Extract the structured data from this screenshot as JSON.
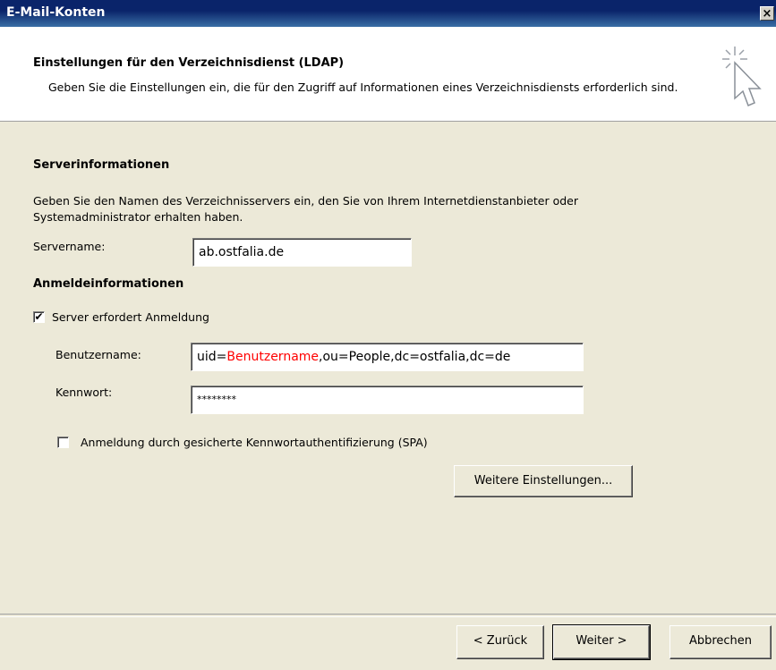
{
  "window": {
    "title": "E-Mail-Konten",
    "close_label": "×"
  },
  "header": {
    "title": "Einstellungen für den Verzeichnisdienst (LDAP)",
    "description": "Geben Sie die Einstellungen ein, die für den Zugriff auf Informationen eines Verzeichnisdiensts erforderlich sind.",
    "icon": "cursor-sparkle-icon"
  },
  "server_info": {
    "heading": "Serverinformationen",
    "description": "Geben Sie den Namen des Verzeichnisservers ein, den Sie von Ihrem Internetdienstanbieter oder Systemadministrator erhalten haben.",
    "servername_label": "Servername:",
    "servername_value": "ab.ostfalia.de"
  },
  "login_info": {
    "heading": "Anmeldeinformationen",
    "requires_login_label": "Server erfordert Anmeldung",
    "requires_login_checked": "✔",
    "username_label": "Benutzername:",
    "username_prefix": "uid=",
    "username_highlight": "Benutzername",
    "username_suffix": ",ou=People,dc=ostfalia,dc=de",
    "password_label": "Kennwort:",
    "password_value": "********",
    "spa_label": "Anmeldung durch gesicherte Kennwortauthentifizierung (SPA)",
    "more_settings_button": "Weitere Einstellungen..."
  },
  "footer": {
    "back_button": "< Zurück",
    "next_button": "Weiter >",
    "cancel_button": "Abbrechen"
  },
  "colors": {
    "titlebar": "#0a246a",
    "highlight_text": "#ff0000",
    "dialog_bg": "#ece9d8"
  }
}
